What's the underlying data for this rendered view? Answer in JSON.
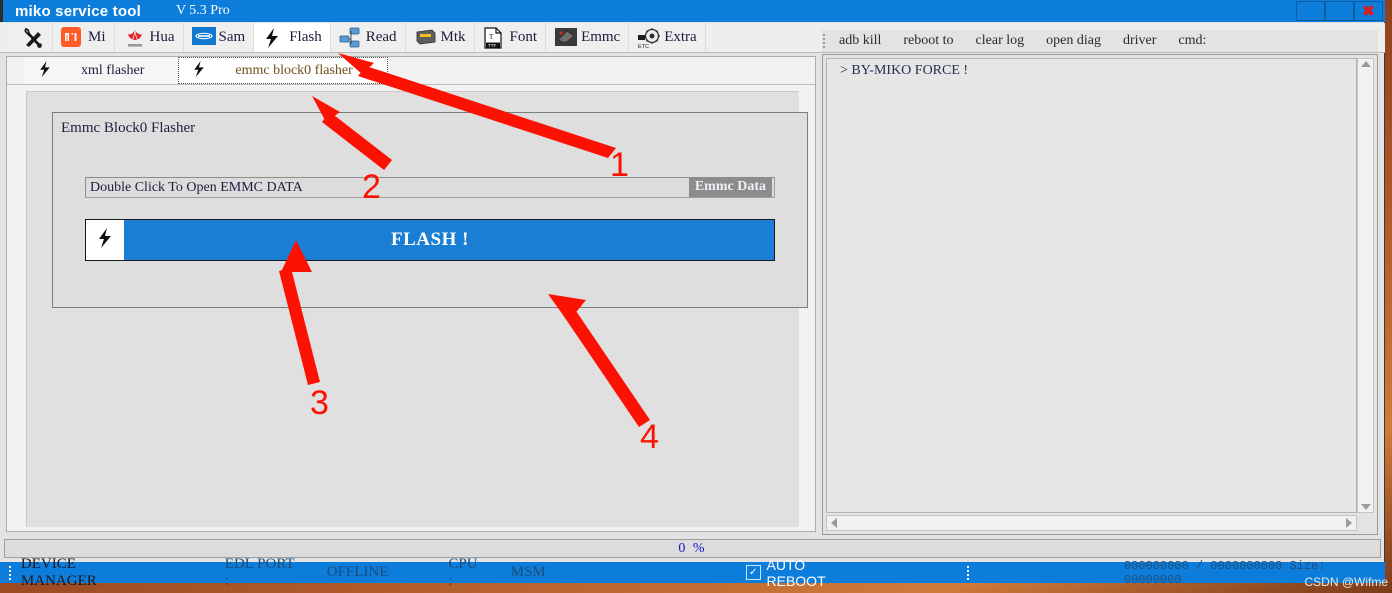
{
  "window": {
    "title": "miko service tool",
    "version": "V 5.3 Pro",
    "title_buttons": [
      {
        "name": "minimize",
        "glyph": ""
      },
      {
        "name": "maximize",
        "glyph": ""
      },
      {
        "name": "close",
        "glyph": "✖"
      }
    ],
    "accent_color": "#0d7ddb"
  },
  "toolbar": {
    "items": [
      {
        "label": "",
        "icon": "tools-icon",
        "active": false
      },
      {
        "label": "Mi",
        "icon": "xiaomi-icon",
        "active": false
      },
      {
        "label": "Hua",
        "icon": "huawei-icon",
        "active": false
      },
      {
        "label": "Sam",
        "icon": "samsung-icon",
        "active": false
      },
      {
        "label": "Flash",
        "icon": "lightning-icon",
        "active": true
      },
      {
        "label": "Read",
        "icon": "network-read-icon",
        "active": false
      },
      {
        "label": "Mtk",
        "icon": "mtk-chip-icon",
        "active": false
      },
      {
        "label": "Font",
        "icon": "ttf-font-icon",
        "active": false
      },
      {
        "label": "Emmc",
        "icon": "emmc-chip-icon",
        "active": false
      },
      {
        "label": "Extra",
        "icon": "extra-gear-icon",
        "active": false
      }
    ]
  },
  "subtabs": [
    {
      "label": "xml flasher",
      "icon": "lightning-icon",
      "selected": false
    },
    {
      "label": "emmc block0 flasher",
      "icon": "lightning-icon",
      "selected": true
    }
  ],
  "groupbox": {
    "title": "Emmc Block0 Flasher",
    "path_value": "Double Click To Open EMMC DATA",
    "emmc_data_label": "Emmc Data",
    "flash_label": "FLASH !",
    "flash_icon": "lightning-icon",
    "flash_color": "#1a7fd4"
  },
  "right_panel": {
    "menu": [
      {
        "label": "adb kill"
      },
      {
        "label": "reboot to"
      },
      {
        "label": "clear log"
      },
      {
        "label": "open diag"
      },
      {
        "label": "driver"
      },
      {
        "label": "cmd:"
      }
    ],
    "log_lines": [
      "> BY-MIKO FORCE !"
    ]
  },
  "progress": {
    "value": 0,
    "text": "0  %"
  },
  "statusbar": {
    "device_manager": "DEVICE MANAGER",
    "edl_port_label": "EDL PORT :",
    "edl_port_value": "OFFLINE",
    "cpu_label": "CPU :",
    "cpu_value": "MSM",
    "auto_reboot_label": "AUTO REBOOT",
    "auto_reboot_checked": true,
    "counters": "000000000 / 0000000000 Size: 00000000"
  },
  "annotations": [
    {
      "number": "1"
    },
    {
      "number": "2"
    },
    {
      "number": "3"
    },
    {
      "number": "4"
    }
  ],
  "watermark": "CSDN @Wifme"
}
